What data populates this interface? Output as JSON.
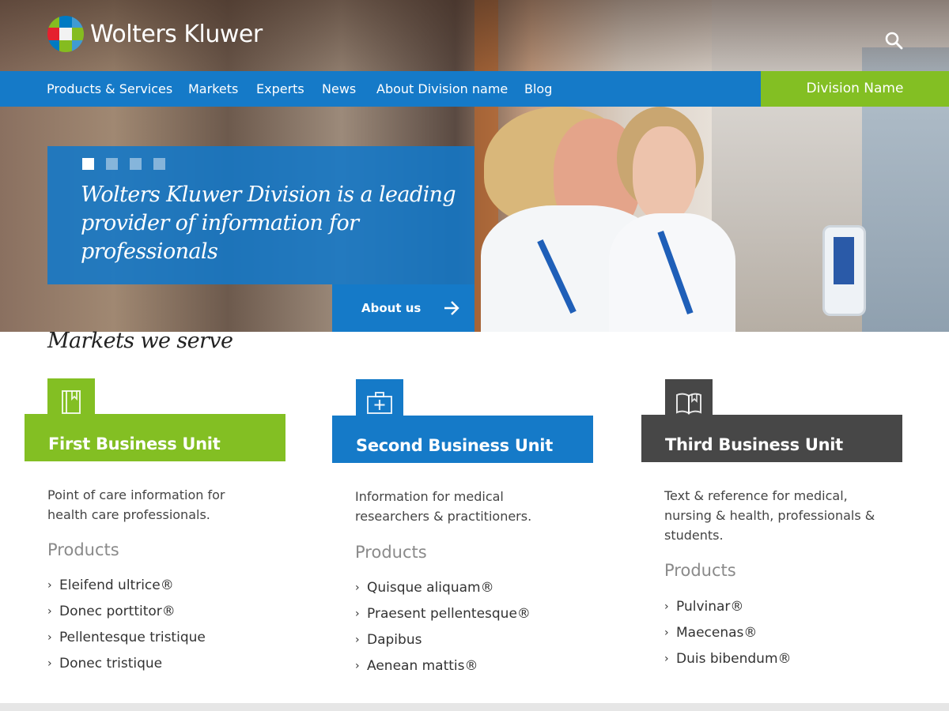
{
  "header": {
    "brand": "Wolters Kluwer",
    "logo_colors": [
      "#85bc20",
      "#007ac3",
      "#409bd2",
      "#e5202e",
      "#f2f2f2",
      "#85bc20",
      "#007ac3",
      "#85bc20",
      "#409bd2"
    ],
    "search_icon": "search-icon"
  },
  "nav": {
    "items": [
      "Products & Services",
      "Markets",
      "Experts",
      "News",
      "About Division name",
      "Blog"
    ],
    "division": "Division Name"
  },
  "hero": {
    "slides": 4,
    "active_slide": 1,
    "headline": "Wolters Kluwer Division is a leading provider of information for professionals",
    "about_button": "About us",
    "about_icon": "arrow-right-icon"
  },
  "markets": {
    "title": "Markets we serve",
    "units": [
      {
        "title": "First Business Unit",
        "color": "#83bf23",
        "icon": "book-icon",
        "description": "Point of care information for health care professionals.",
        "products_label": "Products",
        "products": [
          "Eleifend ultrice®",
          "Donec porttitor®",
          "Pellentesque tristique",
          "Donec tristique"
        ]
      },
      {
        "title": "Second Business Unit",
        "color": "#157ac8",
        "icon": "medical-kit-icon",
        "description": "Information for medical researchers & practitioners.",
        "products_label": "Products",
        "products": [
          "Quisque aliquam®",
          "Praesent pellentesque®",
          "Dapibus",
          "Aenean mattis®"
        ]
      },
      {
        "title": "Third Business Unit",
        "color": "#474747",
        "icon": "open-book-icon",
        "description": "Text & reference for medical, nursing & health, professionals & students.",
        "products_label": "Products",
        "products": [
          "Pulvinar®",
          "Maecenas®",
          "Duis bibendum®"
        ]
      }
    ]
  }
}
